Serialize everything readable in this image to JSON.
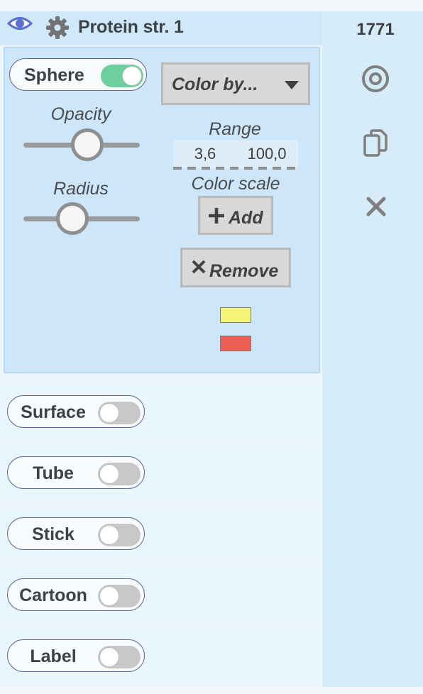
{
  "header": {
    "title": "Protein str. 1",
    "count": "1771"
  },
  "sphere": {
    "label": "Sphere",
    "enabled": true,
    "opacity_label": "Opacity",
    "opacity_value": 0.55,
    "radius_label": "Radius",
    "radius_value": 0.42,
    "color_by": "Color by...",
    "range_label": "Range",
    "range_min": "3,6",
    "range_max": "100,0",
    "color_scale_label": "Color scale",
    "add_label": "Add",
    "remove_label": "Remove",
    "color_scale": [
      "#f6f57a",
      "#ec5f55"
    ]
  },
  "representations": [
    {
      "label": "Surface",
      "enabled": false
    },
    {
      "label": "Tube",
      "enabled": false
    },
    {
      "label": "Stick",
      "enabled": false
    },
    {
      "label": "Cartoon",
      "enabled": false
    },
    {
      "label": "Label",
      "enabled": false
    }
  ],
  "icons": {
    "visibility": "eye-icon",
    "settings": "gear-icon",
    "focus": "target-icon",
    "duplicate": "copy-icon",
    "delete": "close-icon"
  },
  "colors": {
    "toggle_on": "#6ccf9d",
    "toggle_off": "#c8c8c8",
    "accent": "#5e6ca2"
  }
}
